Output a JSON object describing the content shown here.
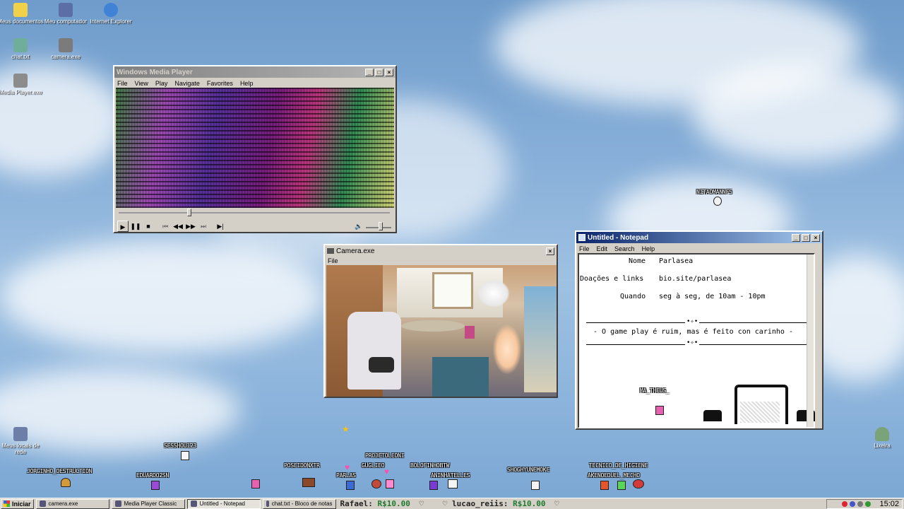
{
  "desktop": {
    "icons": [
      {
        "label": "Meus documentos",
        "icon": "folder-icon",
        "color": "#f2d14a"
      },
      {
        "label": "Meu computador",
        "icon": "computer-icon",
        "color": "#5b6ea5"
      },
      {
        "label": "Internet Explorer",
        "icon": "ie-icon",
        "color": "#3f82d6"
      },
      {
        "label": "chat.txt",
        "icon": "text-file-icon",
        "color": "#6fae9a"
      },
      {
        "label": "camera.exe",
        "icon": "camera-icon",
        "color": "#7b7b7b"
      },
      {
        "label": "Media Player.exe",
        "icon": "media-player-icon",
        "color": "#8c8c8c"
      },
      {
        "label": "Meus locais de rede",
        "icon": "network-icon",
        "color": "#6d7fa8"
      },
      {
        "label": "Lixeira",
        "icon": "recycle-bin-icon",
        "color": "#7aa37a"
      }
    ]
  },
  "wmp": {
    "title": "Windows Media Player",
    "menu": [
      "File",
      "View",
      "Play",
      "Navigate",
      "Favorites",
      "Help"
    ],
    "progress": 0.26,
    "volume": 0.6
  },
  "camera": {
    "title": "Camera.exe",
    "menu": [
      "File"
    ]
  },
  "notepad": {
    "title": "Untitled - Notepad",
    "menu": [
      "File",
      "Edit",
      "Search",
      "Help"
    ],
    "lines": [
      {
        "label": "Nome",
        "value": "Parlasea"
      },
      {
        "label": "Doações e links",
        "value": "bio.site/parlasea"
      },
      {
        "label": "Quando",
        "value": "seg à seg, de 10am - 10pm"
      }
    ],
    "ornament": "•✧•",
    "banner": "- O game play é ruim, mas é feito con carinho -",
    "chat_user": "MA_THEUS_"
  },
  "chat_users": [
    {
      "name": "NITAOMANNFS"
    },
    {
      "name": "JORGINHO_DESTRUCTION"
    },
    {
      "name": "EDUARDO2SN"
    },
    {
      "name": "SESSHOU123"
    },
    {
      "name": "POSEIDONXTR"
    },
    {
      "name": "PARLAS"
    },
    {
      "name": "GUGLIEO"
    },
    {
      "name": "PROJETOLEONI"
    },
    {
      "name": "BOLOFINHOBTW"
    },
    {
      "name": "ANINHATELLES"
    },
    {
      "name": "SHOGHYUNEMOKE"
    },
    {
      "name": "TECNICO_DE_HIGIENE"
    },
    {
      "name": "AKENOEDUEL_MECHO"
    }
  ],
  "taskbar": {
    "start": "Iniciar",
    "items": [
      {
        "label": "camera.exe",
        "pressed": false
      },
      {
        "label": "Media Player Classic",
        "pressed": false
      },
      {
        "label": "Untitled - Notepad",
        "pressed": true
      },
      {
        "label": "chat.txt - Bloco de notas",
        "pressed": false
      }
    ],
    "ticker": [
      {
        "user": "Rafael:",
        "amount": "R$10.00"
      },
      {
        "user": "lucao_reiis:",
        "amount": "R$10.00"
      }
    ],
    "clock": "15:02"
  }
}
